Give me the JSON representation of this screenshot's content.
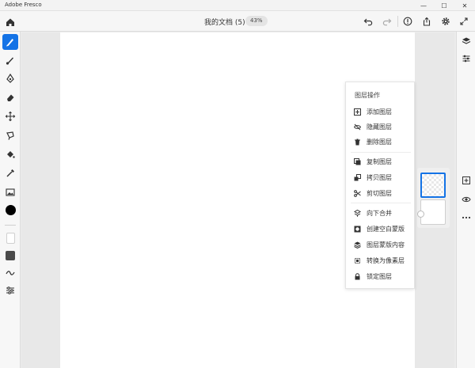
{
  "window": {
    "title": "Adobe Fresco",
    "controls": [
      "—",
      "☐",
      "✕"
    ]
  },
  "toolbar": {
    "doc_title": "我的文档 (5)",
    "zoom": "43%"
  },
  "layer_menu": {
    "header": "图层操作",
    "groups": [
      [
        {
          "label": "添加图层",
          "icon": "add-layer-icon"
        },
        {
          "label": "隐藏图层",
          "icon": "hide-layer-icon"
        },
        {
          "label": "删除图层",
          "icon": "delete-layer-icon"
        }
      ],
      [
        {
          "label": "复制图层",
          "icon": "duplicate-layer-icon"
        },
        {
          "label": "拷贝图层",
          "icon": "copy-layer-icon"
        },
        {
          "label": "剪切图层",
          "icon": "cut-layer-icon"
        }
      ],
      [
        {
          "label": "向下合并",
          "icon": "merge-down-icon"
        },
        {
          "label": "创建空白蒙版",
          "icon": "mask-icon"
        },
        {
          "label": "图层蒙版内容",
          "icon": "mask-content-icon"
        },
        {
          "label": "转换为像素层",
          "icon": "convert-pixel-icon"
        },
        {
          "label": "锁定图层",
          "icon": "lock-icon"
        }
      ]
    ]
  },
  "colors": {
    "accent": "#1473e6",
    "current_color": "#000000"
  }
}
